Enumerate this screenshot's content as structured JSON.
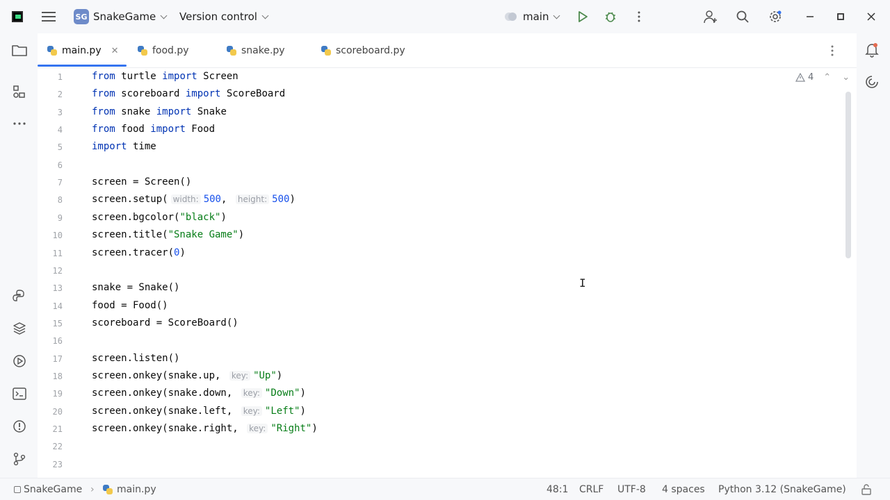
{
  "titlebar": {
    "project_badge": "SG",
    "project_name": "SnakeGame",
    "vcs_label": "Version control",
    "branch": "main"
  },
  "tabs": [
    {
      "label": "main.py",
      "active": true
    },
    {
      "label": "food.py",
      "active": false
    },
    {
      "label": "snake.py",
      "active": false
    },
    {
      "label": "scoreboard.py",
      "active": false
    }
  ],
  "editor": {
    "warnings_count": "4",
    "line_numbers": [
      "1",
      "2",
      "3",
      "4",
      "5",
      "6",
      "7",
      "8",
      "9",
      "10",
      "11",
      "12",
      "13",
      "14",
      "15",
      "16",
      "17",
      "18",
      "19",
      "20",
      "21",
      "22",
      "23"
    ],
    "lines": [
      [
        {
          "t": "from",
          "c": "kw"
        },
        {
          "t": " turtle "
        },
        {
          "t": "import",
          "c": "kw"
        },
        {
          "t": " Screen"
        }
      ],
      [
        {
          "t": "from",
          "c": "kw"
        },
        {
          "t": " scoreboard "
        },
        {
          "t": "import",
          "c": "kw"
        },
        {
          "t": " ScoreBoard"
        }
      ],
      [
        {
          "t": "from",
          "c": "kw"
        },
        {
          "t": " snake "
        },
        {
          "t": "import",
          "c": "kw"
        },
        {
          "t": " Snake"
        }
      ],
      [
        {
          "t": "from",
          "c": "kw"
        },
        {
          "t": " food "
        },
        {
          "t": "import",
          "c": "kw"
        },
        {
          "t": " Food"
        }
      ],
      [
        {
          "t": "import",
          "c": "kw"
        },
        {
          "t": " time"
        }
      ],
      [],
      [
        {
          "t": "screen = Screen()"
        }
      ],
      [
        {
          "t": "screen.setup("
        },
        {
          "t": "width:",
          "c": "hint"
        },
        {
          "t": "500",
          "c": "num"
        },
        {
          "t": ", "
        },
        {
          "t": "height:",
          "c": "hint"
        },
        {
          "t": "500",
          "c": "num"
        },
        {
          "t": ")"
        }
      ],
      [
        {
          "t": "screen.bgcolor("
        },
        {
          "t": "\"black\"",
          "c": "str"
        },
        {
          "t": ")"
        }
      ],
      [
        {
          "t": "screen.title("
        },
        {
          "t": "\"Snake Game\"",
          "c": "str"
        },
        {
          "t": ")"
        }
      ],
      [
        {
          "t": "screen.tracer("
        },
        {
          "t": "0",
          "c": "num"
        },
        {
          "t": ")"
        }
      ],
      [],
      [
        {
          "t": "snake = Snake()"
        }
      ],
      [
        {
          "t": "food = Food()"
        }
      ],
      [
        {
          "t": "scoreboard = ScoreBoard()"
        }
      ],
      [],
      [
        {
          "t": "screen.listen()"
        }
      ],
      [
        {
          "t": "screen.onkey(snake.up, "
        },
        {
          "t": "key:",
          "c": "hint"
        },
        {
          "t": "\"Up\"",
          "c": "str"
        },
        {
          "t": ")"
        }
      ],
      [
        {
          "t": "screen.onkey(snake.down, "
        },
        {
          "t": "key:",
          "c": "hint"
        },
        {
          "t": "\"Down\"",
          "c": "str"
        },
        {
          "t": ")"
        }
      ],
      [
        {
          "t": "screen.onkey(snake.left, "
        },
        {
          "t": "key:",
          "c": "hint"
        },
        {
          "t": "\"Left\"",
          "c": "str"
        },
        {
          "t": ")"
        }
      ],
      [
        {
          "t": "screen.onkey(snake.right, "
        },
        {
          "t": "key:",
          "c": "hint"
        },
        {
          "t": "\"Right\"",
          "c": "str"
        },
        {
          "t": ")"
        }
      ],
      [],
      []
    ]
  },
  "statusbar": {
    "breadcrumb_project": "SnakeGame",
    "breadcrumb_file": "main.py",
    "position": "48:1",
    "line_ending": "CRLF",
    "encoding": "UTF-8",
    "indent": "4 spaces",
    "interpreter": "Python 3.12 (SnakeGame)"
  },
  "colors": {
    "accent": "#3574f0",
    "keyword": "#0033b3",
    "string": "#067d17",
    "number": "#1750eb"
  },
  "icons": [
    "app-logo",
    "hamburger-icon",
    "branch-icon",
    "run-icon",
    "debug-icon",
    "more-icon",
    "add-user-icon",
    "search-icon",
    "settings-icon",
    "minimize-icon",
    "maximize-icon",
    "close-icon",
    "folder-icon",
    "structure-icon",
    "more-tools-icon",
    "python-console-icon",
    "layers-icon",
    "services-icon",
    "terminal-icon",
    "problems-icon",
    "git-icon",
    "notifications-icon",
    "ai-assistant-icon",
    "lock-icon"
  ]
}
